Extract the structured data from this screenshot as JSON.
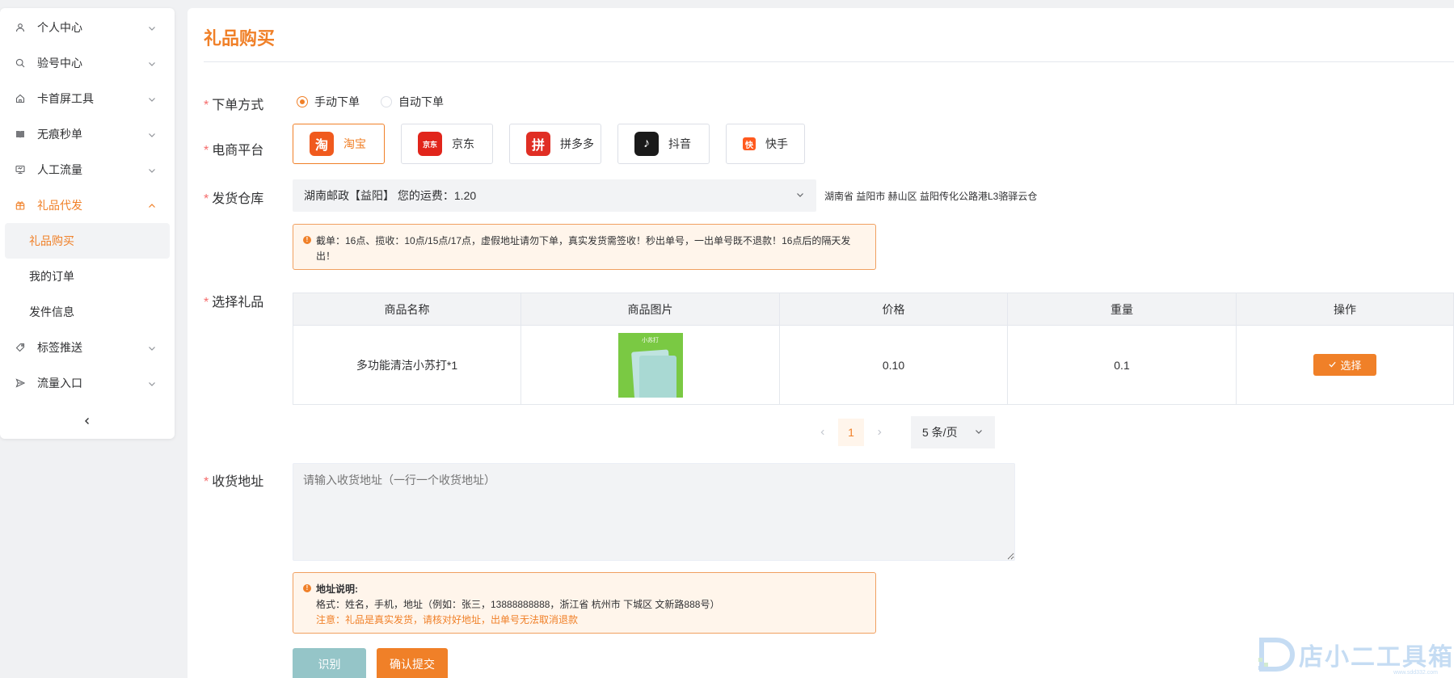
{
  "sidebar": {
    "items": [
      {
        "label": "个人中心",
        "icon": "user-icon"
      },
      {
        "label": "验号中心",
        "icon": "search-icon"
      },
      {
        "label": "卡首屏工具",
        "icon": "home-icon"
      },
      {
        "label": "无痕秒单",
        "icon": "book-icon"
      },
      {
        "label": "人工流量",
        "icon": "monitor-icon"
      },
      {
        "label": "礼品代发",
        "icon": "gift-icon"
      },
      {
        "label": "标签推送",
        "icon": "tag-icon"
      },
      {
        "label": "流量入口",
        "icon": "send-icon"
      }
    ],
    "sub_items": [
      "礼品购买",
      "我的订单",
      "发件信息"
    ]
  },
  "page": {
    "title": "礼品购买"
  },
  "form": {
    "order_mode": {
      "label": "下单方式",
      "options": [
        "手动下单",
        "自动下单"
      ],
      "selected": "手动下单"
    },
    "platform": {
      "label": "电商平台",
      "options": [
        {
          "label": "淘宝",
          "logo": "淘",
          "color": "#f05a1e"
        },
        {
          "label": "京东",
          "logo": "京东",
          "color": "#e1251b"
        },
        {
          "label": "拼多多",
          "logo": "拼",
          "color": "#e02e24"
        },
        {
          "label": "抖音",
          "logo": "♪",
          "color": "#1a1a1a"
        },
        {
          "label": "快手",
          "logo": "快",
          "color": "#ff5a1f"
        }
      ],
      "selected": "淘宝"
    },
    "warehouse": {
      "label": "发货仓库",
      "value": "湖南邮政【益阳】 您的运费：1.20",
      "address": "湖南省 益阳市 赫山区 益阳传化公路港L3骆驿云仓"
    },
    "warehouse_notice": "截单：16点、揽收：10点/15点/17点，虚假地址请勿下单，真实发货需签收！秒出单号，一出单号既不退款！16点后的隔天发出！",
    "gift": {
      "label": "选择礼品",
      "columns": [
        "商品名称",
        "商品图片",
        "价格",
        "重量",
        "操作"
      ],
      "rows": [
        {
          "name": "多功能清洁小苏打*1",
          "image_text": "小苏打",
          "price": "0.10",
          "weight": "0.1",
          "action": "选择"
        }
      ]
    },
    "pagination": {
      "current": "1",
      "page_size": "5 条/页"
    },
    "address": {
      "label": "收货地址",
      "placeholder": "请输入收货地址（一行一个收货地址）",
      "notice_title": "地址说明:",
      "notice_format": "格式：姓名，手机，地址（例如：张三，13888888888，浙江省 杭州市 下城区 文新路888号）",
      "notice_warning": "注意：礼品是真实发货，请核对好地址，出单号无法取消退款"
    },
    "buttons": {
      "recognize": "识别",
      "submit": "确认提交"
    }
  },
  "watermark": {
    "text": "店小二工具箱",
    "url": "www.sdd332.com"
  },
  "colors": {
    "accent": "#f08028",
    "required": "#f56c6c",
    "recognize_btn": "#95c5c8"
  }
}
